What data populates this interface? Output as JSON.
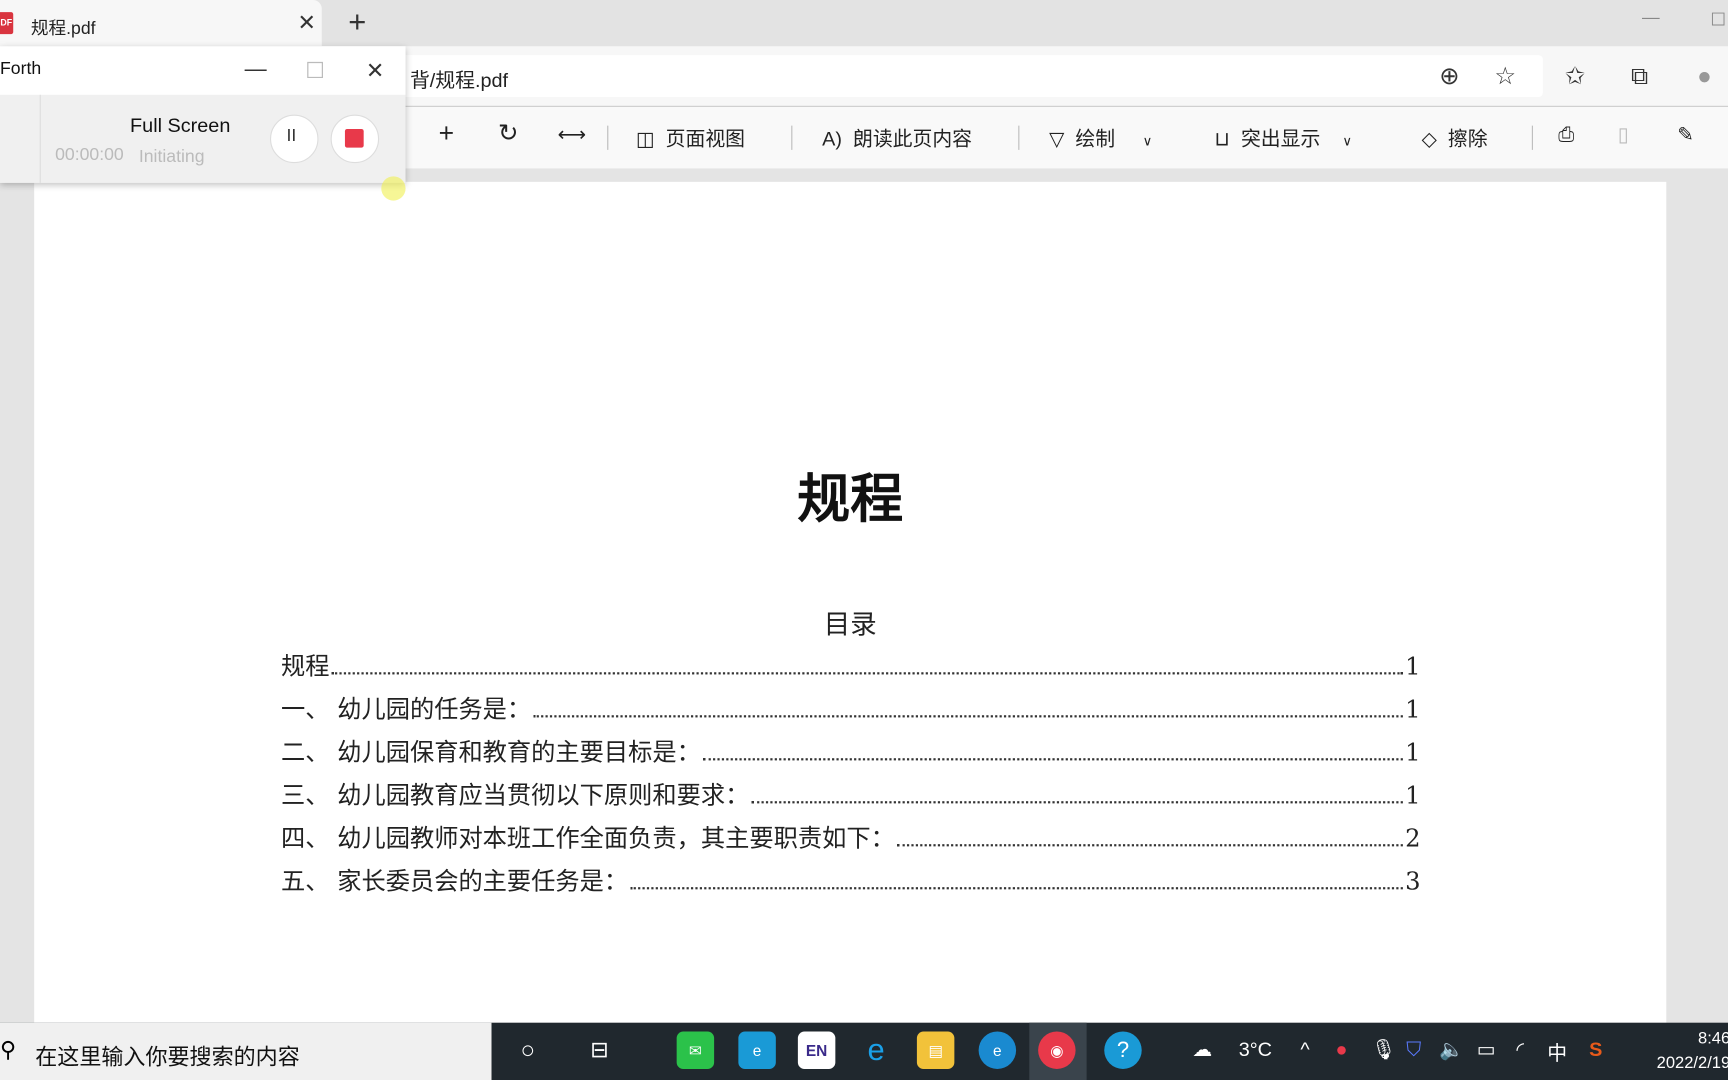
{
  "browser": {
    "tab_title": "规程.pdf",
    "url": "背/规程.pdf",
    "colors": {
      "pdf_icon": "#d9343f"
    }
  },
  "pdf_toolbar": {
    "page_view": "页面视图",
    "read_aloud": "朗读此页内容",
    "draw": "绘制",
    "highlight": "突出显示",
    "erase": "擦除"
  },
  "recorder": {
    "app_name": "Forth",
    "mode": "Full Screen",
    "timer": "00:00:00",
    "status": "Initiating",
    "colors": {
      "stop": "#e8394a"
    }
  },
  "document": {
    "title": "规程",
    "toc_heading": "目录",
    "toc": [
      {
        "label": "规程",
        "page": "1"
      },
      {
        "label": "一、  幼儿园的任务是：",
        "page": "1"
      },
      {
        "label": "二、  幼儿园保育和教育的主要目标是：",
        "page": "1"
      },
      {
        "label": "三、  幼儿园教育应当贯彻以下原则和要求：",
        "page": "1"
      },
      {
        "label": "四、  幼儿园教师对本班工作全面负责，其主要职责如下：",
        "page": "2"
      },
      {
        "label": "五、  家长委员会的主要任务是：",
        "page": "3"
      }
    ]
  },
  "taskbar": {
    "search_placeholder": "在这里输入你要搜索的内容",
    "weather": "3°C",
    "ime": "中",
    "time": "8:46",
    "date": "2022/2/19"
  }
}
